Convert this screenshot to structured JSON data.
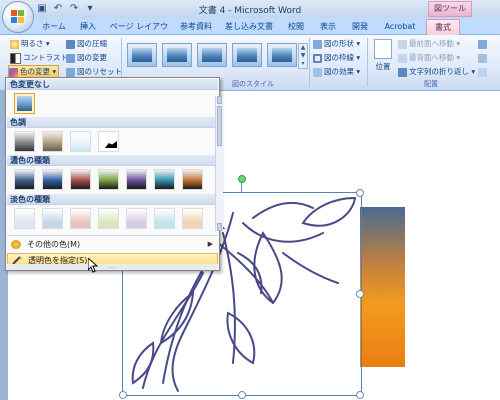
{
  "window": {
    "title": "文書 4 - Microsoft Word",
    "context_tools_label": "図ツール"
  },
  "quick_access": [
    "save-icon",
    "undo-icon",
    "redo-icon",
    "customize-icon"
  ],
  "tabs": [
    {
      "label": "ホーム"
    },
    {
      "label": "挿入"
    },
    {
      "label": "ページ レイアウト"
    },
    {
      "label": "参考資料"
    },
    {
      "label": "差し込み文書"
    },
    {
      "label": "校閲"
    },
    {
      "label": "表示"
    },
    {
      "label": "開発"
    },
    {
      "label": "Acrobat"
    },
    {
      "label": "書式"
    }
  ],
  "ribbon": {
    "adjust": {
      "brightness": "明るさ ▾",
      "contrast": "コントラスト ▾",
      "recolor": "色の変更 ▾",
      "compress": "図の圧縮",
      "change": "図の変更",
      "reset": "図のリセット"
    },
    "styles": {
      "group_label": "図のスタイル"
    },
    "picture_tools": {
      "shape": "図の形状 ▾",
      "border": "図の枠線 ▾",
      "effects": "図の効果 ▾"
    },
    "arrange": {
      "position": "位置",
      "front": "最前面へ移動 ▾",
      "back": "最背面へ移動 ▾",
      "wrap": "文字列の折り返し ▾",
      "group_label": "配置"
    }
  },
  "recolor_menu": {
    "section_none": "色変更なし",
    "section_tone": "色調",
    "section_dark": "濃色の種類",
    "section_light": "淡色の種類",
    "more_colors": "その他の色(M)",
    "set_transparent": "透明色を指定(S)",
    "dark_colors": [
      "#3e5b8a",
      "#2f5fa0",
      "#a24a43",
      "#7a9f3e",
      "#6a4f9a",
      "#2f90a8",
      "#c2702d"
    ],
    "light_colors": [
      "#dfe6ef",
      "#c5d5ea",
      "#e9c3c1",
      "#d7e6bf",
      "#d5cbe6",
      "#c3e3eb",
      "#f1d3b5"
    ]
  }
}
